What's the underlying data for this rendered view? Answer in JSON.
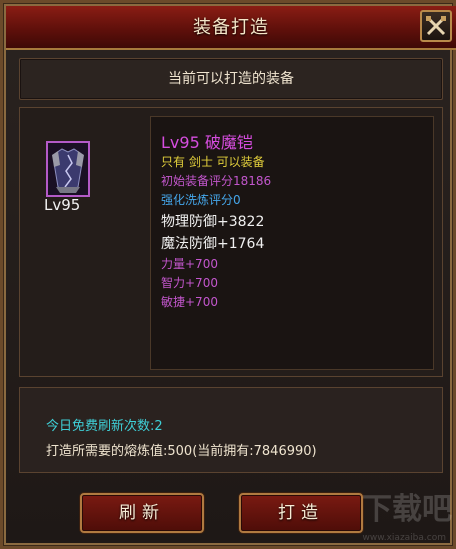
{
  "window": {
    "title": "装备打造"
  },
  "header": {
    "text": "当前可以打造的装备"
  },
  "item": {
    "level": "Lv95",
    "name": "Lv95 破魔铠",
    "class_req": "只有 剑士 可以装备",
    "base_score": "初始装备评分18186",
    "enhance_score": "强化洗炼评分0",
    "phys_def": "物理防御+3822",
    "mag_def": "魔法防御+1764",
    "strength": "力量+700",
    "intellect": "智力+700",
    "agility": "敏捷+700"
  },
  "footer": {
    "refresh_count": "今日免费刷新次数:2",
    "forge_cost": "打造所需要的熔炼值:500(当前拥有:7846990)"
  },
  "buttons": {
    "refresh": "刷新",
    "forge": "打造"
  },
  "watermark": {
    "text": "下载吧",
    "url": "www.xiazaiba.com"
  },
  "colors": {
    "item_name": "#d64ddf",
    "class_req": "#e3d03c",
    "enhance": "#45a6ea",
    "refresh_count": "#3fcfd6"
  }
}
